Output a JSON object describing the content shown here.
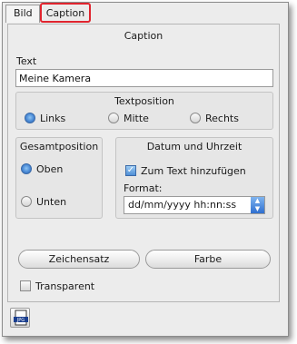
{
  "tabs": {
    "bild": "Bild",
    "caption": "Caption"
  },
  "caption_section": {
    "header": "Caption",
    "text_label": "Text",
    "text_value": "Meine Kamera"
  },
  "textposition": {
    "header": "Textposition",
    "options": [
      "Links",
      "Mitte",
      "Rechts"
    ],
    "selected": "Links"
  },
  "gesamtposition": {
    "header": "Gesamtposition",
    "options": [
      "Oben",
      "Unten"
    ],
    "selected": "Oben"
  },
  "datum": {
    "header": "Datum und Uhrzeit",
    "checkbox_label": "Zum Text hinzufügen",
    "checkbox_checked": true,
    "format_label": "Format:",
    "format_value": "dd/mm/yyyy hh:nn:ss"
  },
  "buttons": {
    "zeichensatz": "Zeichensatz",
    "farbe": "Farbe"
  },
  "transparent": {
    "label": "Transparent",
    "checked": false
  },
  "icons": {
    "jpg_icon": "jpg-file-icon",
    "accent": "#e0242e",
    "radio_selected": "#4a8ad6"
  }
}
